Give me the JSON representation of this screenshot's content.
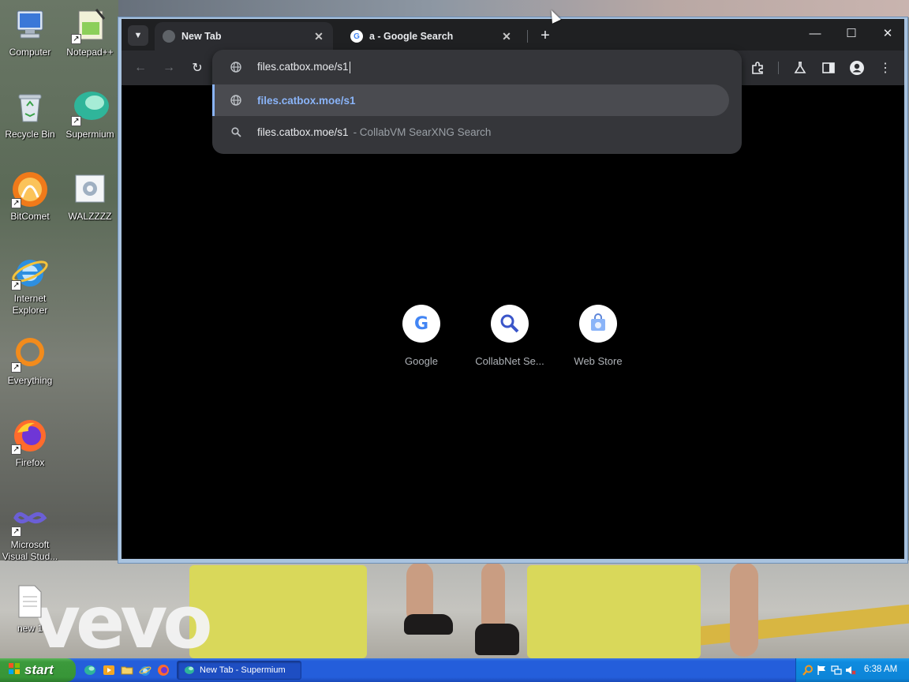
{
  "desktop": {
    "icons": [
      {
        "label": "Computer",
        "icon": "computer-icon"
      },
      {
        "label": "Notepad++",
        "icon": "notepad-plus-plus-icon"
      },
      {
        "label": "Recycle Bin",
        "icon": "recycle-bin-icon"
      },
      {
        "label": "Supermium",
        "icon": "supermium-icon"
      },
      {
        "label": "BitComet",
        "icon": "bitcomet-icon"
      },
      {
        "label": "WALZZZZ",
        "icon": "walzzzz-icon"
      },
      {
        "label": "Internet Explorer",
        "icon": "internet-explorer-icon"
      },
      {
        "label": "Everything",
        "icon": "everything-icon"
      },
      {
        "label": "Firefox",
        "icon": "firefox-icon"
      },
      {
        "label": "Microsoft Visual Stud...",
        "icon": "visual-studio-icon"
      },
      {
        "label": "new 1",
        "icon": "text-file-icon"
      }
    ],
    "wallpaper_text": "vevo"
  },
  "browser": {
    "tabs": [
      {
        "title": "New Tab",
        "active": true,
        "icon": "globe-icon"
      },
      {
        "title": "a - Google Search",
        "active": false,
        "icon": "google-icon"
      }
    ],
    "omnibox": {
      "value": "files.catbox.moe/s1",
      "suggestions": [
        {
          "text": "files.catbox.moe/s1",
          "desc": "",
          "type": "url",
          "selected": true
        },
        {
          "text": "files.catbox.moe/s1",
          "desc": "- CollabVM SearXNG Search",
          "type": "search",
          "selected": false
        }
      ]
    },
    "shortcuts": [
      {
        "label": "Google",
        "icon": "google-icon"
      },
      {
        "label": "CollabNet Se...",
        "icon": "magnifier-icon"
      },
      {
        "label": "Web Store",
        "icon": "web-store-icon"
      }
    ]
  },
  "taskbar": {
    "start_label": "start",
    "task_button": "New Tab - Supermium",
    "clock": "6:38 AM"
  },
  "colors": {
    "accent": "#8ab4f8",
    "taskbar": "#245edb",
    "start": "#379537"
  }
}
